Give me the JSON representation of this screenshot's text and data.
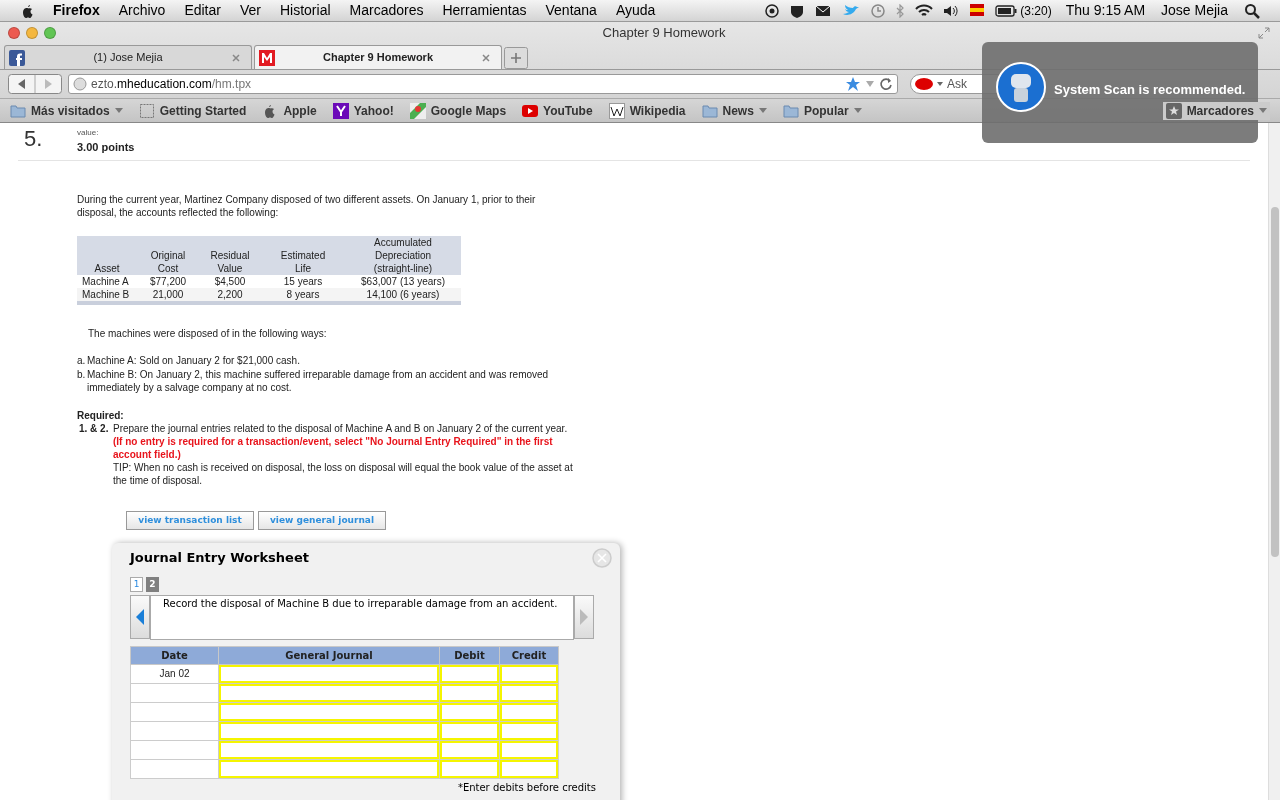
{
  "menubar": {
    "app": "Firefox",
    "menus": [
      "Archivo",
      "Editar",
      "Ver",
      "Historial",
      "Marcadores",
      "Herramientas",
      "Ventana",
      "Ayuda"
    ],
    "battery": "(3:20)",
    "clock": "Thu 9:15 AM",
    "user": "Jose Mejia"
  },
  "window": {
    "title": "Chapter 9 Homework"
  },
  "tabs": [
    {
      "label": "(1) Jose Mejia",
      "selected": false
    },
    {
      "label": "Chapter 9 Homework",
      "selected": true
    }
  ],
  "address": {
    "prefix": "ezto.",
    "domain": "mheducation.com",
    "path": "/hm.tpx"
  },
  "search": {
    "placeholder": "Ask"
  },
  "bookmarks": [
    {
      "label": "Más visitados",
      "kind": "folder-menu"
    },
    {
      "label": "Getting Started",
      "kind": "page"
    },
    {
      "label": "Apple",
      "kind": "apple"
    },
    {
      "label": "Yahoo!",
      "kind": "yahoo"
    },
    {
      "label": "Google Maps",
      "kind": "maps"
    },
    {
      "label": "YouTube",
      "kind": "youtube"
    },
    {
      "label": "Wikipedia",
      "kind": "wiki"
    },
    {
      "label": "News",
      "kind": "folder-menu"
    },
    {
      "label": "Popular",
      "kind": "folder-menu"
    }
  ],
  "bookmarks_menu": "Marcadores",
  "notification": {
    "text": "System Scan is recommended."
  },
  "question": {
    "number": "5.",
    "value_label": "value:",
    "points": "3.00 points",
    "intro": "During the current year, Martinez Company disposed of two different assets. On January 1, prior to their disposal, the accounts reflected the following:",
    "table": {
      "columns": [
        "Asset",
        "Original Cost",
        "Residual Value",
        "Estimated Life",
        "Accumulated Depreciation (straight-line)"
      ],
      "rows": [
        [
          "Machine A",
          "$77,200",
          "$4,500",
          "15 years",
          "$63,007 (13 years)"
        ],
        [
          "Machine B",
          "21,000",
          "2,200",
          "8 years",
          "14,100 (6 years)"
        ]
      ]
    },
    "ways_intro": "The machines were disposed of in the following ways:",
    "ways": [
      {
        "marker": "a.",
        "text": "Machine A: Sold on January 2 for $21,000 cash."
      },
      {
        "marker": "b.",
        "text": "Machine B: On January 2, this machine suffered irreparable damage from an accident and was removed immediately by a salvage company at no cost."
      }
    ],
    "required_label": "Required:",
    "requirement": {
      "marker": "1. & 2.",
      "text": "Prepare the journal entries related to the disposal of Machine A and B on January 2 of the current year. **(If no entry is required for a transaction/event, select \"No Journal Entry Required\" in the first account field.)**",
      "tip": "TIP: When no cash is received on disposal, the loss on disposal will equal the book value of the asset at the time of disposal."
    }
  },
  "buttons": [
    "view transaction list",
    "view general journal"
  ],
  "worksheet": {
    "title": "Journal Entry Worksheet",
    "pages": [
      {
        "label": "1",
        "selected": false
      },
      {
        "label": "2",
        "selected": true
      }
    ],
    "instruction": "Record the disposal of Machine B due to irreparable damage from an accident.",
    "columns": [
      "Date",
      "General Journal",
      "Debit",
      "Credit"
    ],
    "rows": [
      {
        "date": "Jan 02"
      },
      {},
      {},
      {},
      {},
      {}
    ],
    "footnote": "*Enter debits before credits"
  }
}
